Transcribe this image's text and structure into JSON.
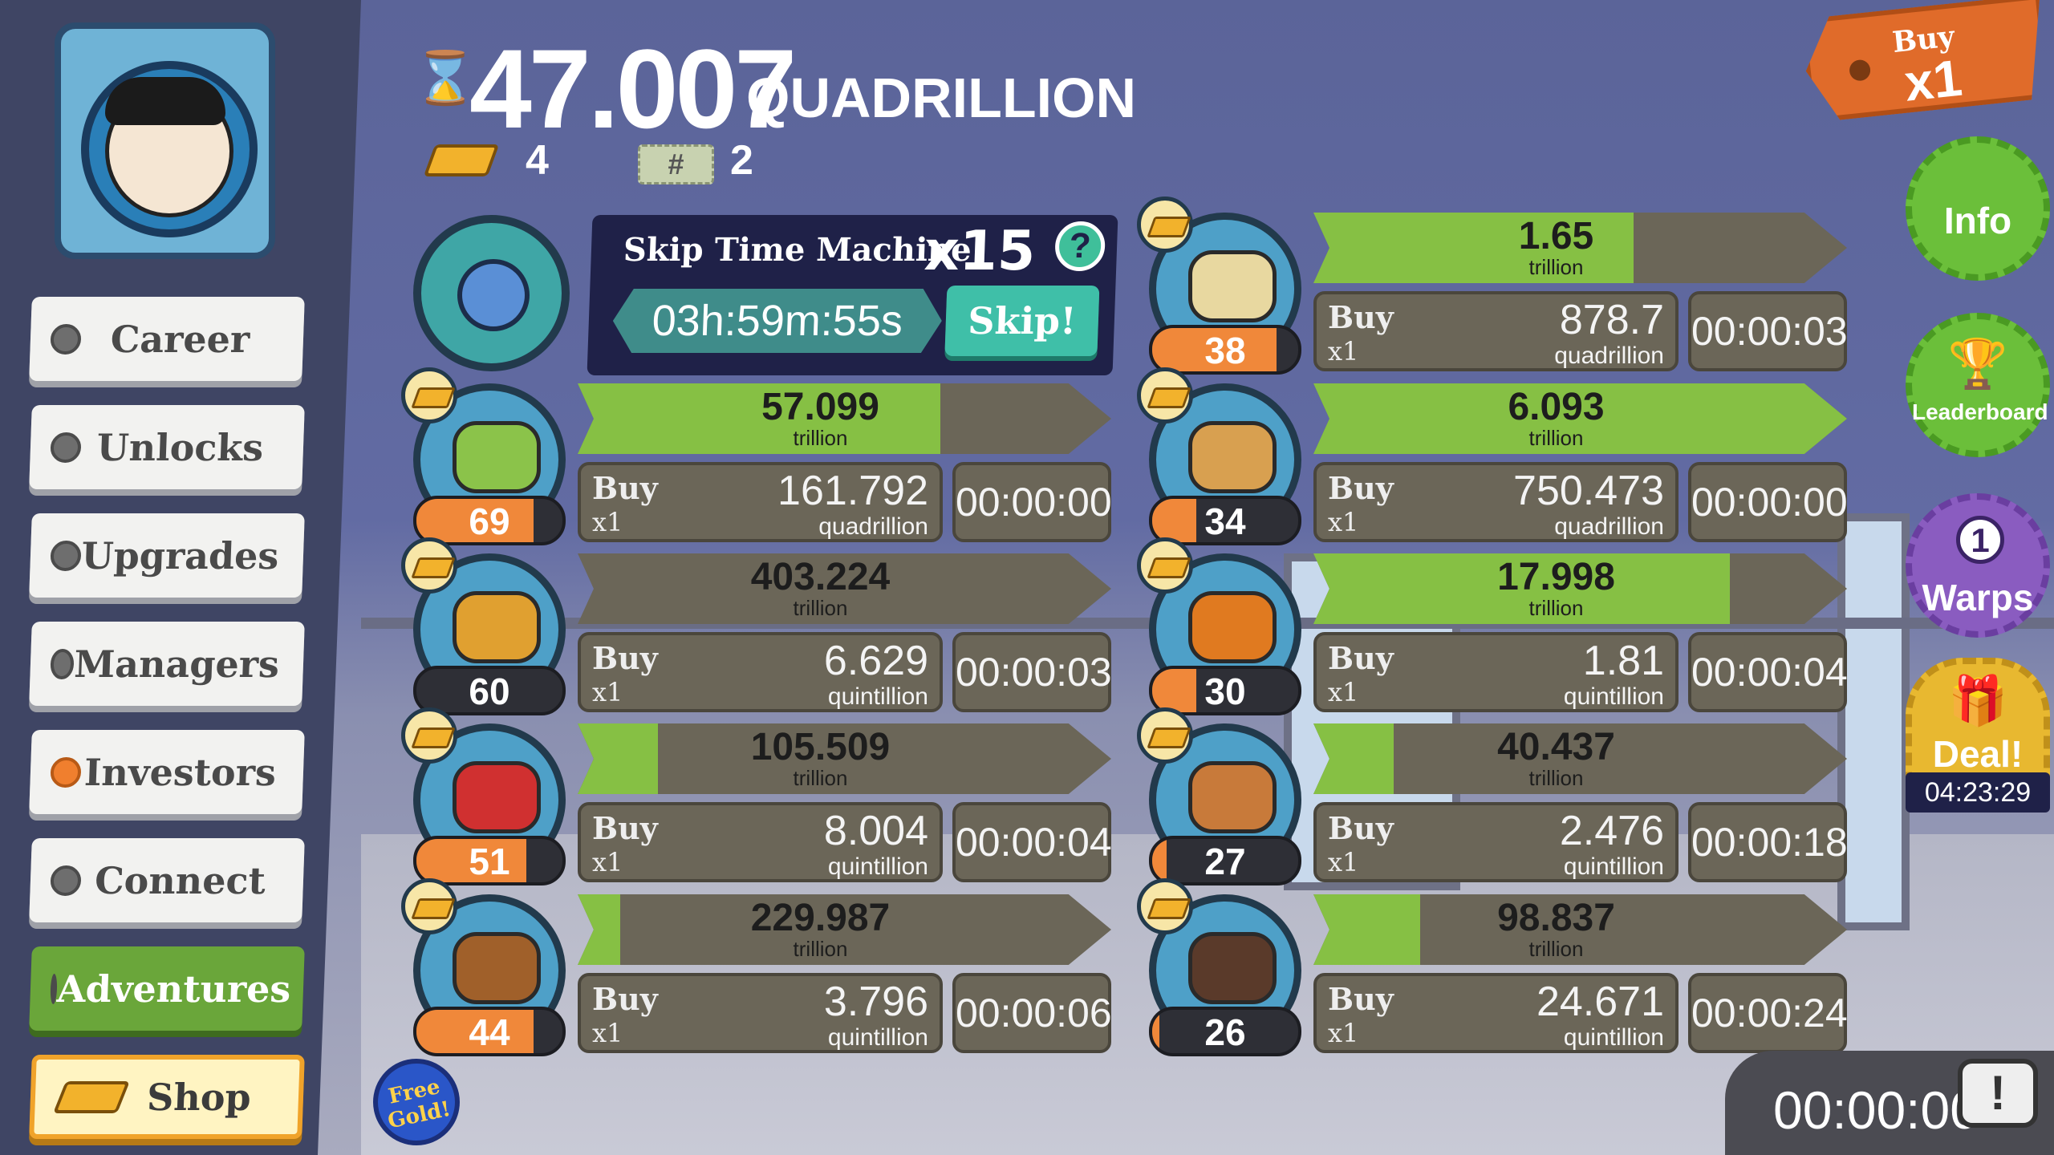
{
  "header": {
    "hourglass": "⌛",
    "money_value": "47.007",
    "money_unit": "QUADRILLION",
    "gold_bars": "4",
    "ticket_label": "#",
    "tickets": "2"
  },
  "sidebar": {
    "items": [
      {
        "label": "Career",
        "dot": "grey"
      },
      {
        "label": "Unlocks",
        "dot": "grey"
      },
      {
        "label": "Upgrades",
        "dot": "grey"
      },
      {
        "label": "Managers",
        "dot": "grey"
      },
      {
        "label": "Investors",
        "dot": "orange"
      },
      {
        "label": "Connect",
        "dot": "grey"
      },
      {
        "label": "Adventures",
        "dot": "grey"
      },
      {
        "label": "Shop"
      }
    ]
  },
  "time_machine": {
    "title": "Skip Time Machine",
    "multiplier": "x15",
    "help": "?",
    "timer": "03h:59m:55s",
    "skip_label": "Skip!"
  },
  "businesses": [
    {
      "icon": "dinosaur-icon",
      "owned": "69",
      "owned_progress": 0.8,
      "revenue": "57.099",
      "revenue_unit": "trillion",
      "progress": 0.68,
      "buy_label": "Buy",
      "buy_mult": "x1",
      "cost": "161.792",
      "cost_unit": "quadrillion",
      "timer": "00:00:00",
      "color": "#8bc34a"
    },
    {
      "icon": "pyramid-icon",
      "owned": "60",
      "owned_progress": 0.0,
      "revenue": "403.224",
      "revenue_unit": "trillion",
      "progress": 0.0,
      "buy_label": "Buy",
      "buy_mult": "x1",
      "cost": "6.629",
      "cost_unit": "quintillion",
      "timer": "00:00:03",
      "color": "#e0a030"
    },
    {
      "icon": "wrench-icon",
      "owned": "51",
      "owned_progress": 0.75,
      "revenue": "105.509",
      "revenue_unit": "trillion",
      "progress": 0.15,
      "buy_label": "Buy",
      "buy_mult": "x1",
      "cost": "8.004",
      "cost_unit": "quintillion",
      "timer": "00:00:04",
      "color": "#d03030"
    },
    {
      "icon": "horse-icon",
      "owned": "44",
      "owned_progress": 0.8,
      "revenue": "229.987",
      "revenue_unit": "trillion",
      "progress": 0.08,
      "buy_label": "Buy",
      "buy_mult": "x1",
      "cost": "3.796",
      "cost_unit": "quintillion",
      "timer": "00:00:06",
      "color": "#a0602a"
    },
    {
      "icon": "sword-icon",
      "owned": "38",
      "owned_progress": 0.85,
      "revenue": "1.65",
      "revenue_unit": "trillion",
      "progress": 0.6,
      "buy_label": "Buy",
      "buy_mult": "x1",
      "cost": "878.7",
      "cost_unit": "quadrillion",
      "timer": "00:00:03",
      "color": "#e8d8a0"
    },
    {
      "icon": "camel-icon",
      "owned": "34",
      "owned_progress": 0.3,
      "revenue": "6.093",
      "revenue_unit": "trillion",
      "progress": 1.0,
      "buy_label": "Buy",
      "buy_mult": "x1",
      "cost": "750.473",
      "cost_unit": "quadrillion",
      "timer": "00:00:00",
      "color": "#d8a050"
    },
    {
      "icon": "crate-icon",
      "owned": "30",
      "owned_progress": 0.3,
      "revenue": "17.998",
      "revenue_unit": "trillion",
      "progress": 0.78,
      "buy_label": "Buy",
      "buy_mult": "x1",
      "cost": "1.81",
      "cost_unit": "quintillion",
      "timer": "00:00:04",
      "color": "#e07a20"
    },
    {
      "icon": "mousetrap-icon",
      "owned": "27",
      "owned_progress": 0.1,
      "revenue": "40.437",
      "revenue_unit": "trillion",
      "progress": 0.15,
      "buy_label": "Buy",
      "buy_mult": "x1",
      "cost": "2.476",
      "cost_unit": "quintillion",
      "timer": "00:00:18",
      "color": "#c87a3a"
    },
    {
      "icon": "pirate-ship-icon",
      "owned": "26",
      "owned_progress": 0.05,
      "revenue": "98.837",
      "revenue_unit": "trillion",
      "progress": 0.2,
      "buy_label": "Buy",
      "buy_mult": "x1",
      "cost": "24.671",
      "cost_unit": "quintillion",
      "timer": "00:00:24",
      "color": "#5a3a2a"
    }
  ],
  "right": {
    "buy_tag_top": "Buy",
    "buy_tag_mult": "x1",
    "info": "Info",
    "leaderboard": "Leaderboard",
    "warps_count": "1",
    "warps": "Warps",
    "deal": "Deal!",
    "deal_timer": "04:23:29"
  },
  "bottom": {
    "timer": "00:00:00",
    "tv_icon": "!",
    "free_gold": "Free Gold!"
  }
}
